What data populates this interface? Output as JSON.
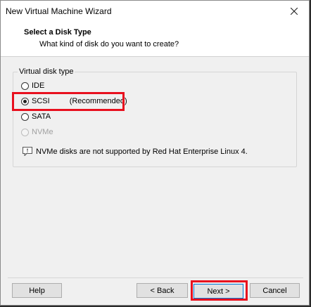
{
  "window": {
    "title": "New Virtual Machine Wizard"
  },
  "header": {
    "title": "Select a Disk Type",
    "subtitle": "What kind of disk do you want to create?"
  },
  "disk_group": {
    "label": "Virtual disk type",
    "options": [
      {
        "label": "IDE",
        "checked": false,
        "disabled": false
      },
      {
        "label": "SCSI",
        "note": "(Recommended)",
        "checked": true,
        "disabled": false
      },
      {
        "label": "SATA",
        "checked": false,
        "disabled": false
      },
      {
        "label": "NVMe",
        "checked": false,
        "disabled": true
      }
    ],
    "info": "NVMe disks are not supported by Red Hat Enterprise Linux 4."
  },
  "buttons": {
    "help": "Help",
    "back": "< Back",
    "next": "Next >",
    "cancel": "Cancel"
  },
  "highlight_color": "#e8101e"
}
